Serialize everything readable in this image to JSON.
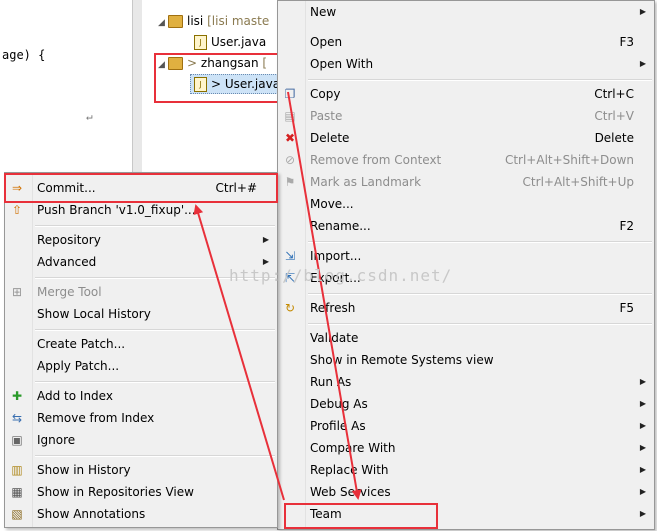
{
  "editor": {
    "code_line": "age) {",
    "return_mark": "↵"
  },
  "tree": {
    "lisi": {
      "name": "lisi",
      "branch": "[lisi maste"
    },
    "lisi_file": "User.java",
    "zhangsan": {
      "prefix": ">",
      "name": "zhangsan",
      "branch": "["
    },
    "zhangsan_file": "> User.java"
  },
  "main_menu": {
    "items": [
      {
        "label": "New",
        "submenu": true
      },
      {
        "label": "Open",
        "accel": "F3"
      },
      {
        "label": "Open With",
        "submenu": true
      },
      {
        "label": "Copy",
        "accel": "Ctrl+C",
        "icon": "copy-icon"
      },
      {
        "label": "Paste",
        "accel": "Ctrl+V",
        "disabled": true,
        "icon": "paste-icon"
      },
      {
        "label": "Delete",
        "accel": "Delete",
        "icon": "delete-icon"
      },
      {
        "label": "Remove from Context",
        "accel": "Ctrl+Alt+Shift+Down",
        "disabled": true,
        "icon": "remove-context-icon"
      },
      {
        "label": "Mark as Landmark",
        "accel": "Ctrl+Alt+Shift+Up",
        "disabled": true,
        "icon": "landmark-icon"
      },
      {
        "label": "Move..."
      },
      {
        "label": "Rename...",
        "accel": "F2"
      },
      {
        "label": "Import...",
        "icon": "import-icon"
      },
      {
        "label": "Export...",
        "icon": "export-icon"
      },
      {
        "label": "Refresh",
        "accel": "F5",
        "icon": "refresh-icon"
      },
      {
        "label": "Validate"
      },
      {
        "label": "Show in Remote Systems view"
      },
      {
        "label": "Run As",
        "submenu": true
      },
      {
        "label": "Debug As",
        "submenu": true
      },
      {
        "label": "Profile As",
        "submenu": true
      },
      {
        "label": "Compare With",
        "submenu": true
      },
      {
        "label": "Replace With",
        "submenu": true
      },
      {
        "label": "Web Services",
        "submenu": true
      },
      {
        "label": "Team",
        "submenu": true
      }
    ]
  },
  "team_menu": {
    "items": [
      {
        "label": "Commit...",
        "accel": "Ctrl+#",
        "icon": "commit-icon"
      },
      {
        "label": "Push Branch 'v1.0_fixup'...",
        "icon": "push-icon"
      },
      {
        "label": "Repository",
        "submenu": true
      },
      {
        "label": "Advanced",
        "submenu": true
      },
      {
        "label": "Merge Tool",
        "disabled": true,
        "icon": "merge-tool-icon"
      },
      {
        "label": "Show Local History"
      },
      {
        "label": "Create Patch..."
      },
      {
        "label": "Apply Patch..."
      },
      {
        "label": "Add to Index",
        "icon": "add-icon"
      },
      {
        "label": "Remove from Index",
        "icon": "remove-index-icon"
      },
      {
        "label": "Ignore",
        "icon": "ignore-icon"
      },
      {
        "label": "Show in History",
        "icon": "history-icon"
      },
      {
        "label": "Show in Repositories View",
        "icon": "git-repo-icon"
      },
      {
        "label": "Show Annotations",
        "icon": "annotations-icon"
      }
    ]
  },
  "watermark": "http://blog.csdn.net/",
  "colors": {
    "annotation": "#e8303a",
    "menu_bg": "#f0f0f0"
  }
}
